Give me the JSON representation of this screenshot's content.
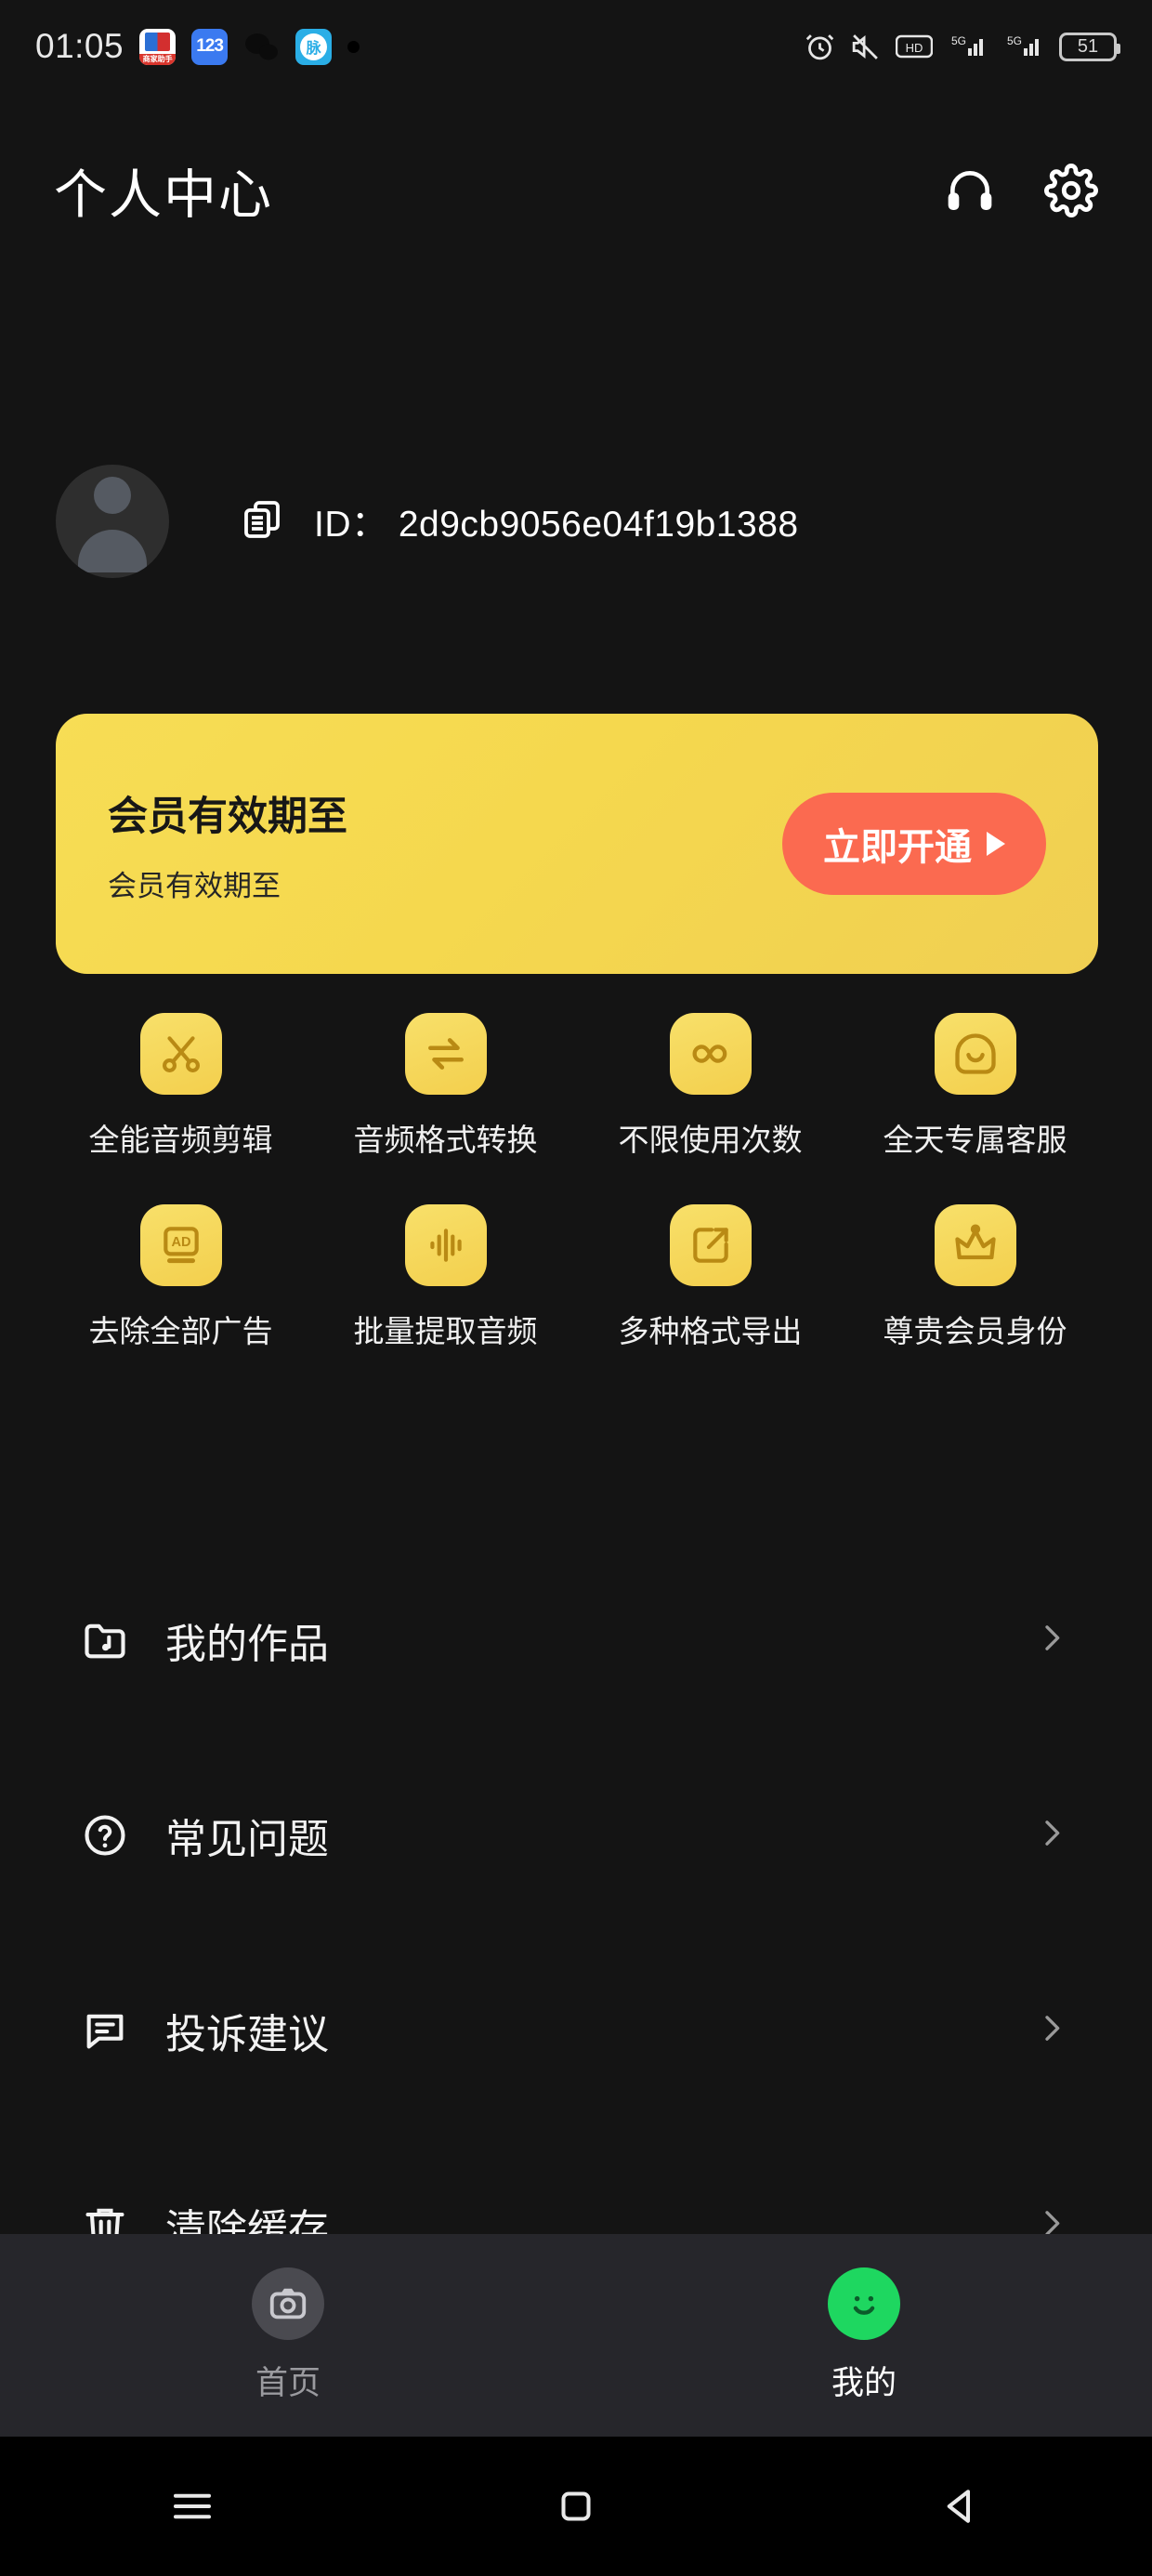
{
  "statusbar": {
    "time": "01:05",
    "app_icons": [
      {
        "name": "merchant-assistant-icon",
        "label": "商家助手"
      },
      {
        "name": "cloud123-icon",
        "label": "123"
      },
      {
        "name": "wechat-icon",
        "label": ""
      },
      {
        "name": "maimai-icon",
        "label": "脉"
      },
      {
        "name": "notification-dot-icon",
        "label": ""
      }
    ],
    "right_icons": [
      {
        "name": "alarm-icon"
      },
      {
        "name": "mute-icon"
      },
      {
        "name": "hd-icon"
      },
      {
        "name": "signal-5g-icon"
      },
      {
        "name": "signal-5g-secondary-icon"
      }
    ],
    "battery_level": "51"
  },
  "header": {
    "title": "个人中心",
    "support_icon": "headset-icon",
    "settings_icon": "gear-icon"
  },
  "profile": {
    "avatar_icon": "avatar-placeholder-icon",
    "copy_icon": "copy-icon",
    "id_text": "ID： 2d9cb9056e04f19b1388"
  },
  "vip_banner": {
    "title": "会员有效期至",
    "subtitle": "会员有效期至",
    "button_label": "立即开通",
    "button_color": "#fb6a50",
    "background_color": "#f5d84e"
  },
  "features": [
    {
      "icon": "scissors-icon",
      "label": "全能音频剪辑"
    },
    {
      "icon": "swap-arrows-icon",
      "label": "音频格式转换"
    },
    {
      "icon": "infinity-icon",
      "label": "不限使用次数"
    },
    {
      "icon": "headset-chat-icon",
      "label": "全天专属客服"
    },
    {
      "icon": "ad-block-icon",
      "label": "去除全部广告"
    },
    {
      "icon": "waveform-icon",
      "label": "批量提取音频"
    },
    {
      "icon": "export-share-icon",
      "label": "多种格式导出"
    },
    {
      "icon": "crown-icon",
      "label": "尊贵会员身份"
    }
  ],
  "menu": [
    {
      "icon": "folder-music-icon",
      "label": "我的作品",
      "chevron": "chevron-right-icon"
    },
    {
      "icon": "question-circle-icon",
      "label": "常见问题",
      "chevron": "chevron-right-icon"
    },
    {
      "icon": "feedback-message-icon",
      "label": "投诉建议",
      "chevron": "chevron-right-icon"
    },
    {
      "icon": "trash-icon",
      "label": "清除缓存",
      "chevron": "chevron-right-icon"
    }
  ],
  "tabbar": [
    {
      "icon": "home-camera-icon",
      "label": "首页",
      "active": false
    },
    {
      "icon": "smiley-face-icon",
      "label": "我的",
      "active": true
    }
  ],
  "navbar": [
    {
      "icon": "recents-menu-icon"
    },
    {
      "icon": "home-square-icon"
    },
    {
      "icon": "back-triangle-icon"
    }
  ]
}
